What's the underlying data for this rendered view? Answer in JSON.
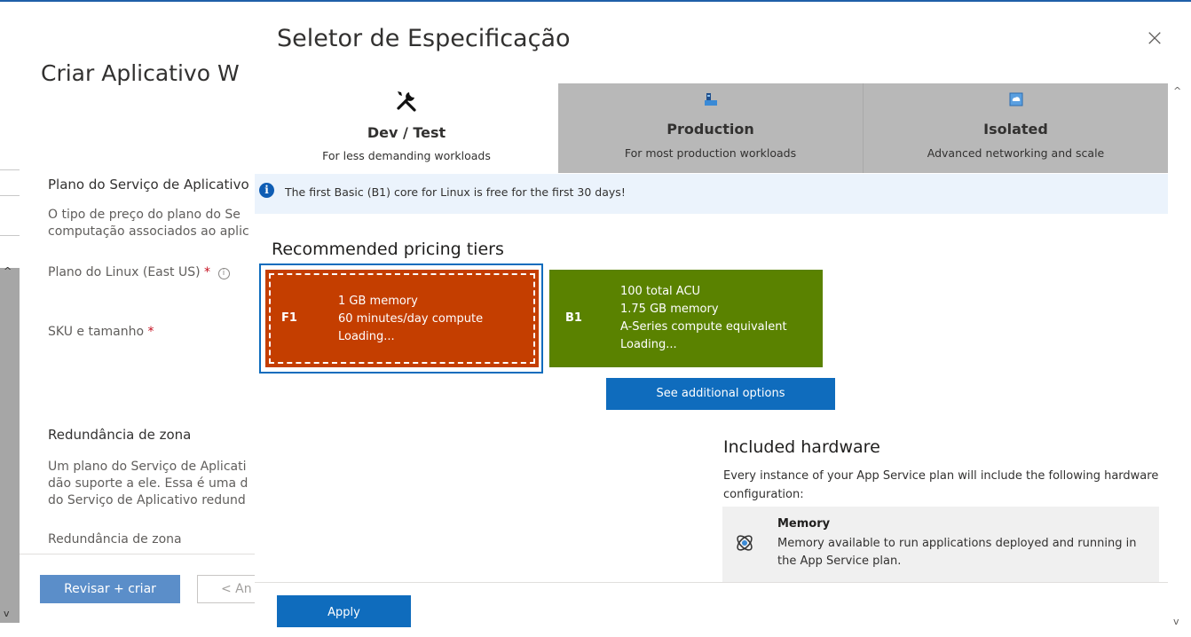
{
  "background": {
    "title": "Criar Aplicativo W",
    "plan_section_label": "Plano do Serviço de Aplicativo",
    "plan_desc_line1": "O tipo de preço do plano do Se",
    "plan_desc_line2": "computação associados ao aplic",
    "linux_plan_label": "Plano do Linux (East US)",
    "required_mark": "*",
    "sku_label": "SKU e tamanho",
    "zone_section_label": "Redundância de zona",
    "zone_desc_line1": "Um plano do Serviço de Aplicati",
    "zone_desc_line2": "dão suporte a ele. Essa é uma d",
    "zone_desc_line3": "do Serviço de Aplicativo redund",
    "zone_field_label": "Redundância de zona",
    "review_button": "Revisar + criar",
    "prev_button": "< An"
  },
  "panel": {
    "title": "Seletor de Especificação",
    "close_glyph": "×",
    "tabs": [
      {
        "name": "Dev / Test",
        "sub": "For less demanding workloads",
        "active": true,
        "icon": "tools-icon"
      },
      {
        "name": "Production",
        "sub": "For most production workloads",
        "active": false,
        "icon": "production-icon"
      },
      {
        "name": "Isolated",
        "sub": "Advanced networking and scale",
        "active": false,
        "icon": "isolated-icon"
      }
    ],
    "info_banner": "The first Basic (B1) core for Linux is free for the first 30 days!",
    "tiers_heading": "Recommended pricing tiers",
    "tiers": [
      {
        "code": "F1",
        "lines": [
          "1 GB memory",
          "60 minutes/day compute",
          "Loading..."
        ],
        "color": "#c43e00",
        "selected": true
      },
      {
        "code": "B1",
        "lines": [
          "100 total ACU",
          "1.75 GB memory",
          "A-Series compute equivalent",
          "Loading..."
        ],
        "color": "#5a8200",
        "selected": false
      }
    ],
    "see_options_button": "See additional options",
    "hardware_heading": "Included hardware",
    "hardware_desc": "Every instance of your App Service plan will include the following hardware configuration:",
    "hardware_card": {
      "title": "Memory",
      "desc": "Memory available to run applications deployed and running in the App Service plan.",
      "icon": "memory-icon"
    },
    "apply_button": "Apply"
  },
  "colors": {
    "accent": "#0f6cbd",
    "f1_tier": "#c43e00",
    "b1_tier": "#5a8200",
    "tab_inactive": "#b8b8b8",
    "info_banner_bg": "#ebf3fc"
  }
}
